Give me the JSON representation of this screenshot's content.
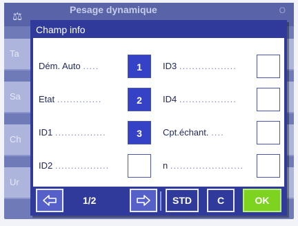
{
  "background": {
    "title": "Pesage dynamique",
    "right_title": "O",
    "rows": [
      "Ta",
      "Sa",
      "Ch",
      "Ur"
    ]
  },
  "dialog": {
    "title": "Champ info",
    "left_fields": [
      {
        "label": "Dém. Auto",
        "value": "1"
      },
      {
        "label": "Etat",
        "value": "2"
      },
      {
        "label": "ID1",
        "value": "3"
      },
      {
        "label": "ID2",
        "value": ""
      }
    ],
    "right_fields": [
      {
        "label": "ID3",
        "value": ""
      },
      {
        "label": "ID4",
        "value": ""
      },
      {
        "label": "Cpt.échant.",
        "value": ""
      },
      {
        "label": "n",
        "value": ""
      }
    ],
    "footer": {
      "page": "1/2",
      "std_label": "STD",
      "c_label": "C",
      "ok_label": "OK"
    }
  }
}
